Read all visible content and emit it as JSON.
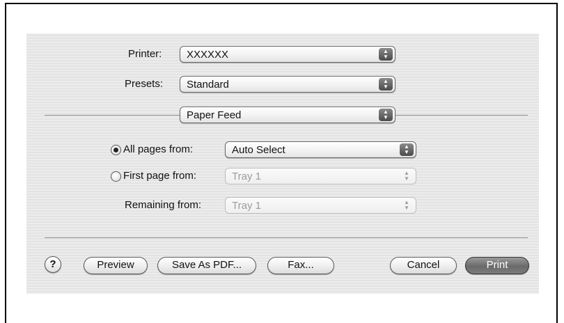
{
  "printer": {
    "label": "Printer:",
    "value": "XXXXXX"
  },
  "presets": {
    "label": "Presets:",
    "value": "Standard"
  },
  "panel": {
    "value": "Paper Feed"
  },
  "paper_feed": {
    "all_pages": {
      "label": "All pages from:",
      "value": "Auto Select",
      "selected": true
    },
    "first_page": {
      "label": "First page from:",
      "value": "Tray 1",
      "selected": false
    },
    "remaining": {
      "label": "Remaining from:",
      "value": "Tray 1"
    }
  },
  "buttons": {
    "help": "?",
    "preview": "Preview",
    "save_pdf": "Save As PDF...",
    "fax": "Fax...",
    "cancel": "Cancel",
    "print": "Print"
  },
  "icons": {
    "popup_arrows": "up-down-arrows-icon",
    "radio": "radio-icon",
    "help": "help-icon"
  }
}
